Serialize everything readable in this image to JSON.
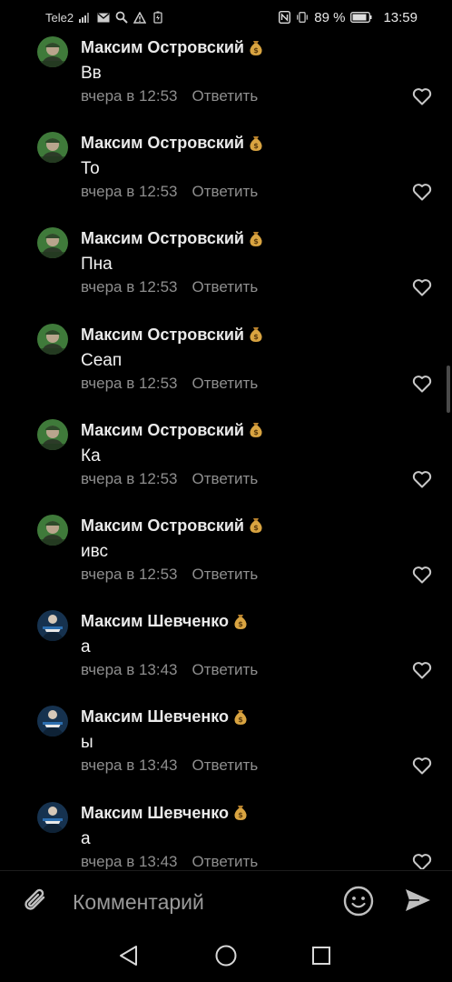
{
  "status_bar": {
    "carrier": "Tele2",
    "battery_percent": "89 %",
    "time": "13:59",
    "icons": [
      "signal-icon",
      "mail-icon",
      "search-icon",
      "alert-icon",
      "battery-saver-icon",
      "nfc-icon",
      "vibrate-icon",
      "battery-icon"
    ]
  },
  "comments": [
    {
      "author": "Максим Островский",
      "text": "Вв",
      "time": "вчера в 12:53",
      "reply_label": "Ответить",
      "avatar": "ostrovsky"
    },
    {
      "author": "Максим Островский",
      "text": "То",
      "time": "вчера в 12:53",
      "reply_label": "Ответить",
      "avatar": "ostrovsky"
    },
    {
      "author": "Максим Островский",
      "text": "Пна",
      "time": "вчера в 12:53",
      "reply_label": "Ответить",
      "avatar": "ostrovsky"
    },
    {
      "author": "Максим Островский",
      "text": "Сеап",
      "time": "вчера в 12:53",
      "reply_label": "Ответить",
      "avatar": "ostrovsky"
    },
    {
      "author": "Максим Островский",
      "text": "Ка",
      "time": "вчера в 12:53",
      "reply_label": "Ответить",
      "avatar": "ostrovsky"
    },
    {
      "author": "Максим Островский",
      "text": "ивс",
      "time": "вчера в 12:53",
      "reply_label": "Ответить",
      "avatar": "ostrovsky"
    },
    {
      "author": "Максим Шевченко",
      "text": "а",
      "time": "вчера в 13:43",
      "reply_label": "Ответить",
      "avatar": "shevchenko"
    },
    {
      "author": "Максим Шевченко",
      "text": "ы",
      "time": "вчера в 13:43",
      "reply_label": "Ответить",
      "avatar": "shevchenko"
    },
    {
      "author": "Максим Шевченко",
      "text": "а",
      "time": "вчера в 13:43",
      "reply_label": "Ответить",
      "avatar": "shevchenko"
    }
  ],
  "composer": {
    "placeholder": "Комментарий",
    "icons": [
      "attach-icon",
      "emoji-icon",
      "send-icon"
    ]
  },
  "nav_bar": {
    "icons": [
      "back-icon",
      "home-icon",
      "recent-apps-icon"
    ]
  },
  "colors": {
    "background": "#000000",
    "primary_text": "#eaeaea",
    "secondary_text": "#8e8e8e",
    "moneybag": "#d9a441"
  }
}
